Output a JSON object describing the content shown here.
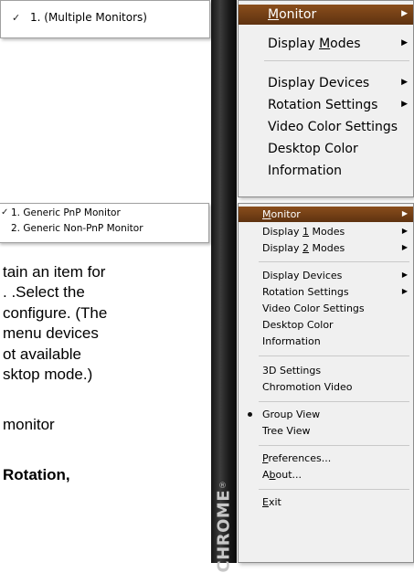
{
  "top_submenu": {
    "item": "1. (Multiple Monitors)",
    "checked": true
  },
  "top_menu": {
    "items": [
      {
        "pre": "",
        "u": "M",
        "post": "onitor",
        "submenu": true,
        "highlighted": true
      },
      {
        "pre": "Display ",
        "u": "M",
        "post": "odes",
        "submenu": true
      },
      {
        "pre": "Display Devices",
        "u": "",
        "post": "",
        "submenu": true
      },
      {
        "pre": "Rotation Settings",
        "u": "",
        "post": "",
        "submenu": true
      },
      {
        "pre": "Video Color Settings",
        "u": "",
        "post": "",
        "submenu": false
      },
      {
        "pre": "Desktop Color",
        "u": "",
        "post": "",
        "submenu": false
      },
      {
        "pre": "Information",
        "u": "",
        "post": "",
        "submenu": false
      }
    ]
  },
  "bottom_submenu": {
    "items": [
      {
        "label": "1. Generic PnP Monitor",
        "checked": true
      },
      {
        "label": "2. Generic Non-PnP Monitor",
        "checked": false
      }
    ]
  },
  "bottom_menu": {
    "items": [
      {
        "pre": "",
        "u": "M",
        "post": "onitor",
        "submenu": true,
        "highlighted": true
      },
      {
        "pre": "Display ",
        "u": "1",
        "post": " Modes",
        "submenu": true
      },
      {
        "pre": "Display ",
        "u": "2",
        "post": " Modes",
        "submenu": true
      },
      {
        "pre": "Display Devices",
        "u": "",
        "post": "",
        "submenu": true
      },
      {
        "pre": "Rotation Settings",
        "u": "",
        "post": "",
        "submenu": true
      },
      {
        "pre": "Video Color Settings",
        "u": "",
        "post": "",
        "submenu": false
      },
      {
        "pre": "Desktop Color",
        "u": "",
        "post": "",
        "submenu": false
      },
      {
        "pre": "Information",
        "u": "",
        "post": "",
        "submenu": false
      },
      {
        "pre": "3D Settings",
        "u": "",
        "post": "",
        "submenu": false
      },
      {
        "pre": "Chromotion Video",
        "u": "",
        "post": "",
        "submenu": false
      },
      {
        "pre": "Group View",
        "u": "",
        "post": "",
        "submenu": false,
        "bullet": true
      },
      {
        "pre": "Tree View",
        "u": "",
        "post": "",
        "submenu": false
      },
      {
        "pre": "",
        "u": "P",
        "post": "references...",
        "submenu": false
      },
      {
        "pre": "A",
        "u": "b",
        "post": "out...",
        "submenu": false
      },
      {
        "pre": "",
        "u": "E",
        "post": "xit",
        "submenu": false
      }
    ]
  },
  "background_text": {
    "lines": [
      "tain an item for",
      ". .Select the",
      "configure. (The",
      "menu devices",
      "ot available",
      "sktop mode.)",
      "monitor",
      "Rotation,"
    ]
  },
  "strip": {
    "logo": "CHROME",
    "reg": "®"
  },
  "glyphs": {
    "check": "✓",
    "arrow": "▶"
  }
}
